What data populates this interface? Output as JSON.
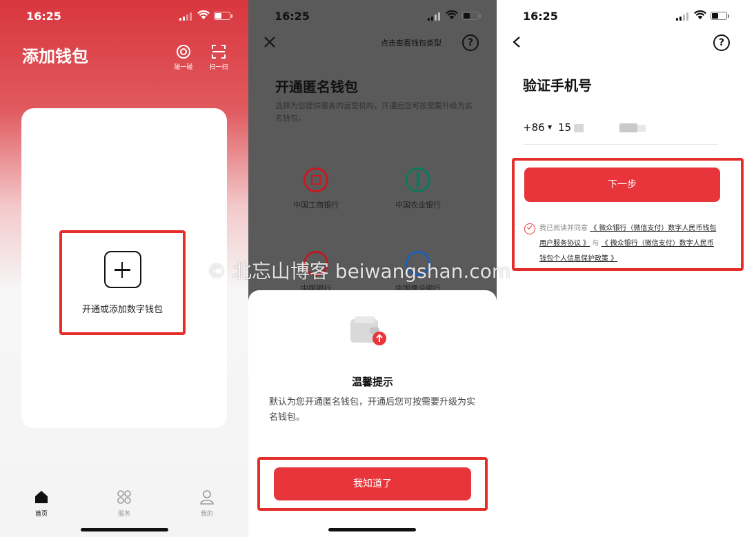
{
  "status_time": "16:25",
  "screen1": {
    "title": "添加钱包",
    "tool_tap": "碰一碰",
    "tool_scan": "扫一扫",
    "add_label": "开通或添加数字钱包",
    "tabs": [
      {
        "label": "首页",
        "icon": "home-icon",
        "active": true
      },
      {
        "label": "服务",
        "icon": "grid-icon",
        "active": false
      },
      {
        "label": "我的",
        "icon": "person-icon",
        "active": false
      }
    ]
  },
  "screen2": {
    "link": "点击查看钱包类型",
    "title": "开通匿名钱包",
    "desc": "选择为您提供服务的运营机构，开通后您可按需要升级为实名钱包。",
    "banks": [
      {
        "name": "中国工商银行",
        "color": "#c8191f"
      },
      {
        "name": "中国农业银行",
        "color": "#0a7a5a"
      },
      {
        "name": "中国银行",
        "color": "#b81c22"
      },
      {
        "name": "中国建设银行",
        "color": "#1c5fb8"
      }
    ],
    "sheet_title": "温馨提示",
    "sheet_body": "默认为您开通匿名钱包，开通后您可按需要升级为实名钱包。",
    "ok_button": "我知道了"
  },
  "screen3": {
    "title": "验证手机号",
    "country_code": "+86",
    "phone_partial": "15",
    "next_button": "下一步",
    "agree_prefix": "我已阅读并同意",
    "agree_link1": "《 微众银行（微信支付）数字人民币钱包用户服务协议 》",
    "agree_and": "与",
    "agree_link2": "《 微众银行（微信支付）数字人民币钱包个人信息保护政策 》"
  },
  "watermark": "© 北忘山博客 beiwangshan.com",
  "colors": {
    "accent": "#e8353b",
    "highlight": "#e52e2a"
  }
}
